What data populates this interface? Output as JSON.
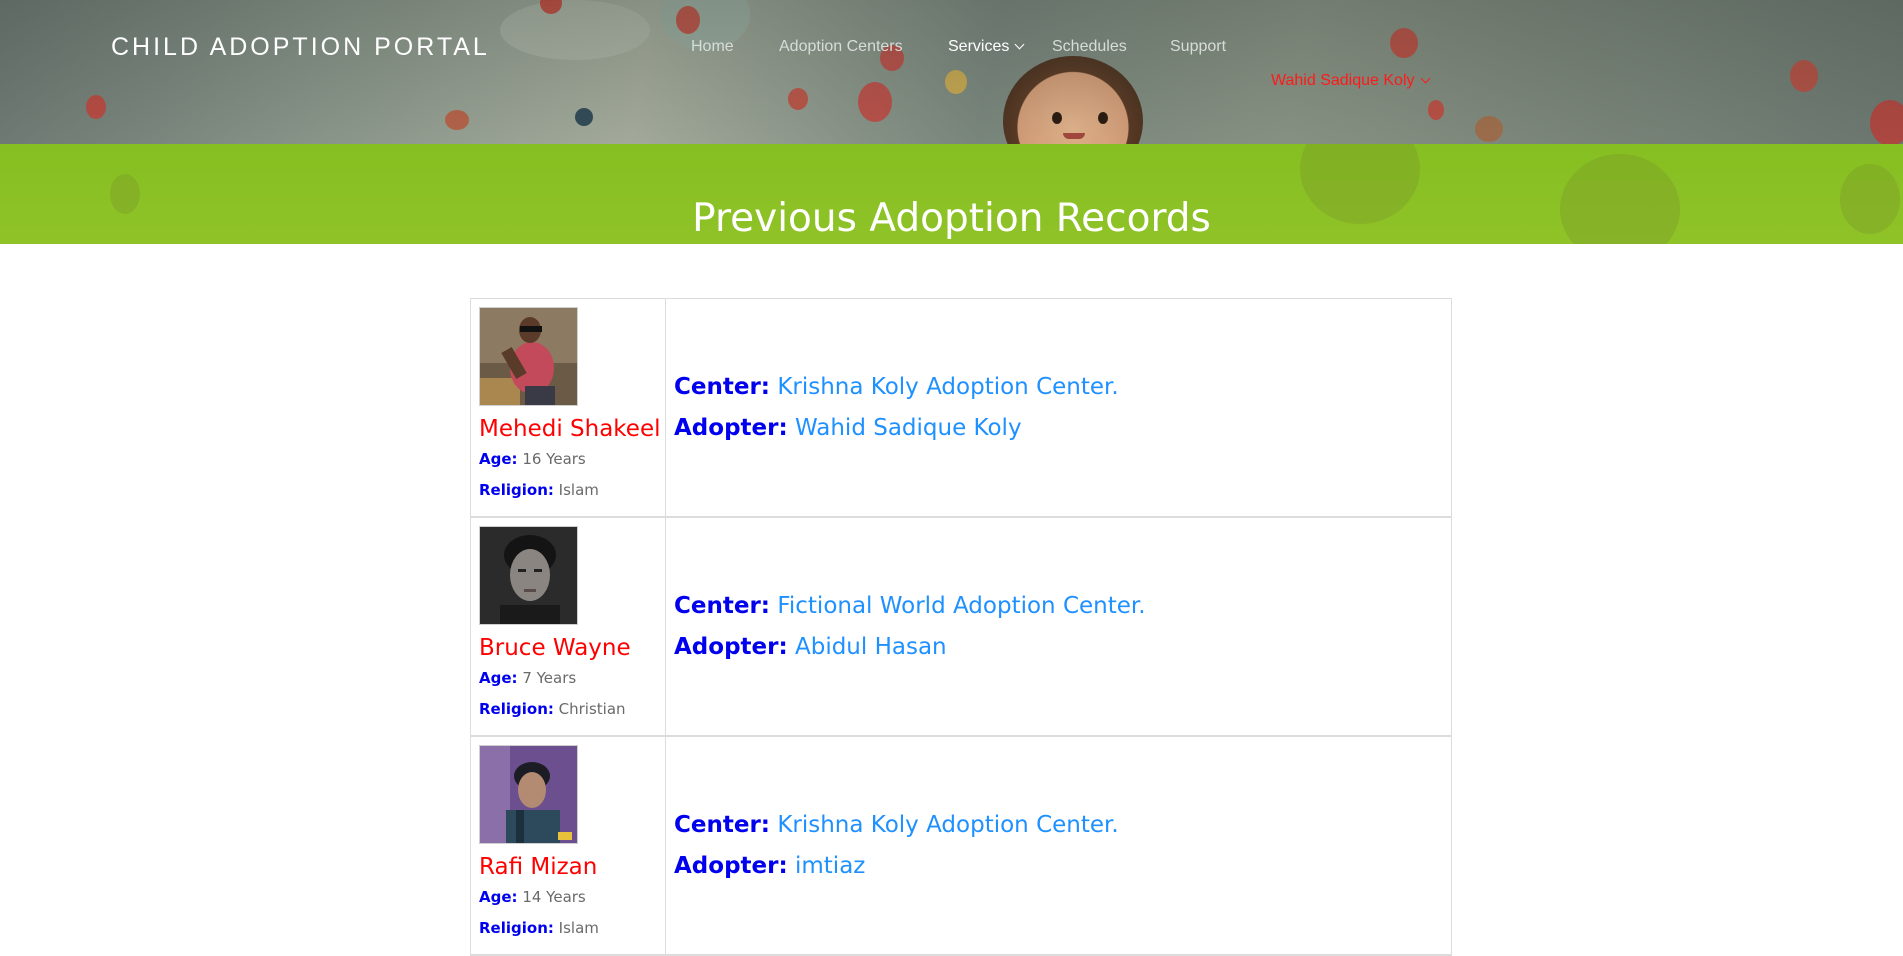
{
  "header": {
    "brand": "CHILD ADOPTION PORTAL",
    "nav": [
      {
        "label": "Home"
      },
      {
        "label": "Adoption Centers"
      },
      {
        "label": "Services"
      },
      {
        "label": "Schedules"
      },
      {
        "label": "Support"
      }
    ],
    "user": "Wahid Sadique Koly"
  },
  "banner": {
    "title": "Previous Adoption Records"
  },
  "labels": {
    "age": "Age:",
    "religion": "Religion:",
    "center": "Center:",
    "adopter": "Adopter:"
  },
  "records": [
    {
      "name": "Mehedi Shakeel",
      "age": "16 Years",
      "religion": "Islam",
      "center": "Krishna Koly Adoption Center.",
      "adopter": "Wahid Sadique Koly"
    },
    {
      "name": "Bruce Wayne",
      "age": "7 Years",
      "religion": "Christian",
      "center": "Fictional World Adoption Center.",
      "adopter": "Abidul Hasan"
    },
    {
      "name": "Rafi Mizan",
      "age": "14 Years",
      "religion": "Islam",
      "center": "Krishna Koly Adoption Center.",
      "adopter": "imtiaz"
    }
  ],
  "colors": {
    "banner": "#8bc220",
    "name": "#ff0000",
    "label": "#0000ee",
    "value_link": "#1e90ff",
    "user": "#ff1a1a"
  }
}
